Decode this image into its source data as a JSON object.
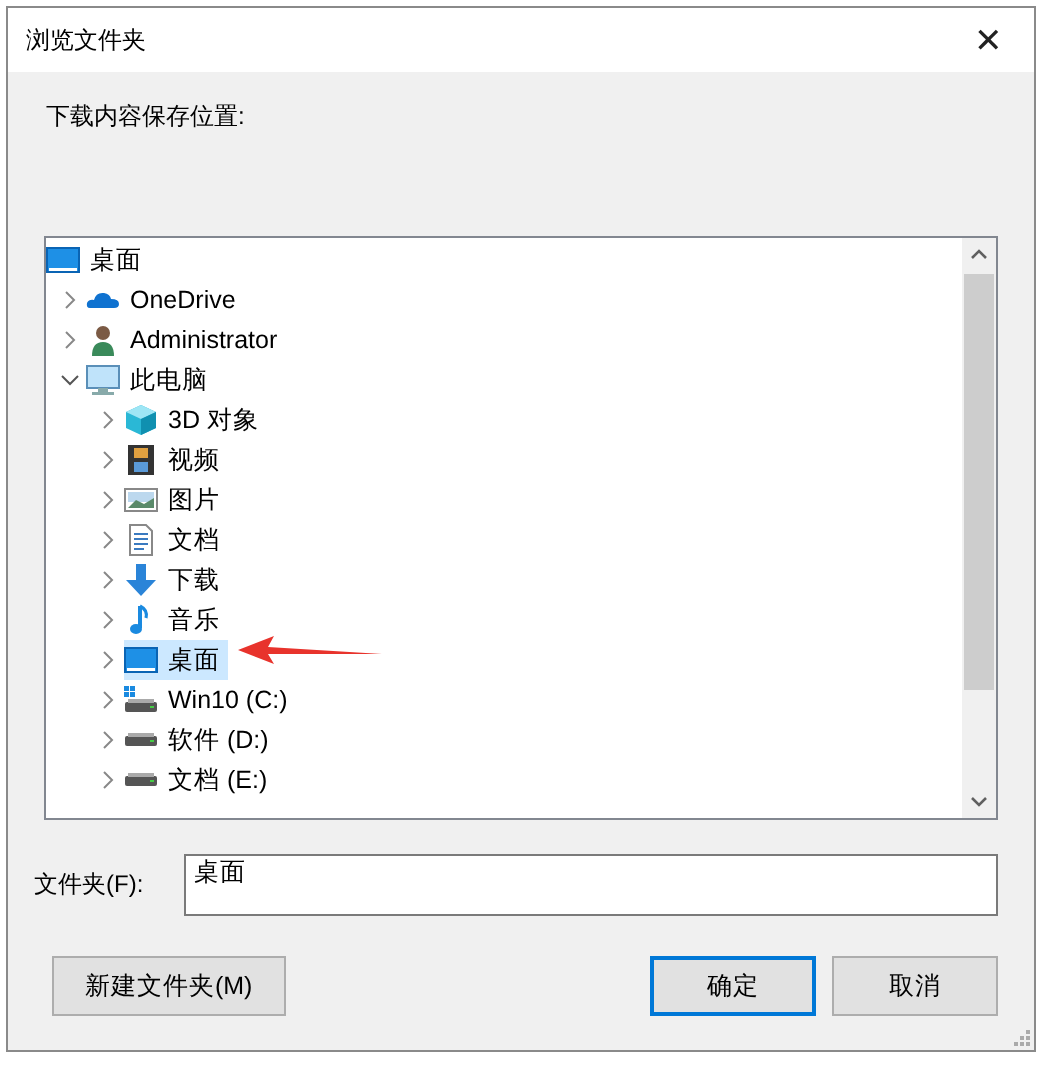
{
  "window": {
    "title": "浏览文件夹",
    "close": "✕"
  },
  "prompt": "下载内容保存位置:",
  "tree": {
    "root": {
      "label": "桌面",
      "kind": "desktop",
      "selected": false
    },
    "children": [
      {
        "label": "OneDrive",
        "kind": "cloud",
        "expanded": false,
        "selected": false
      },
      {
        "label": "Administrator",
        "kind": "user",
        "expanded": false,
        "selected": false
      },
      {
        "label": "此电脑",
        "kind": "computer",
        "expanded": true,
        "selected": false,
        "children": [
          {
            "label": "3D 对象",
            "kind": "cube",
            "expanded": false,
            "selected": false
          },
          {
            "label": "视频",
            "kind": "film",
            "expanded": false,
            "selected": false
          },
          {
            "label": "图片",
            "kind": "image",
            "expanded": false,
            "selected": false
          },
          {
            "label": "文档",
            "kind": "document",
            "expanded": false,
            "selected": false
          },
          {
            "label": "下载",
            "kind": "download",
            "expanded": false,
            "selected": false
          },
          {
            "label": "音乐",
            "kind": "music",
            "expanded": false,
            "selected": false
          },
          {
            "label": "桌面",
            "kind": "desktop",
            "expanded": false,
            "selected": true
          },
          {
            "label": "Win10 (C:)",
            "kind": "system-drive",
            "expanded": false,
            "selected": false
          },
          {
            "label": "软件 (D:)",
            "kind": "drive",
            "expanded": false,
            "selected": false
          },
          {
            "label": "文档 (E:)",
            "kind": "drive",
            "expanded": false,
            "selected": false
          }
        ]
      }
    ]
  },
  "folder": {
    "label": "文件夹(F):",
    "value": "桌面"
  },
  "buttons": [
    {
      "label": "新建文件夹(M)",
      "default": false
    },
    {
      "label": "确定",
      "default": true
    },
    {
      "label": "取消",
      "default": false
    }
  ]
}
